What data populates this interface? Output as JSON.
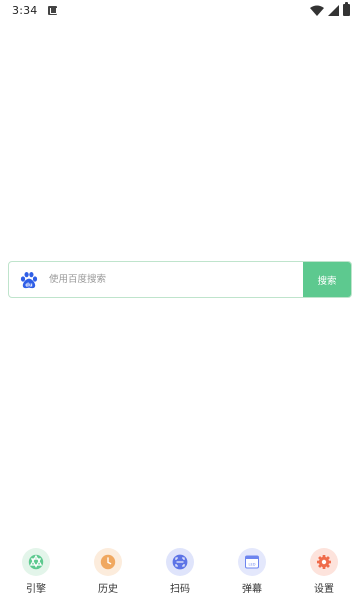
{
  "status_bar": {
    "time": "3:34",
    "icons": [
      "notification-icon",
      "wifi-icon",
      "signal-icon",
      "battery-icon"
    ]
  },
  "search": {
    "engine_icon": "baidu-logo-icon",
    "placeholder": "使用百度搜索",
    "value": "",
    "button_label": "搜索",
    "accent_color": "#5dc98f",
    "border_color": "#bfe4cc"
  },
  "bottom_nav": {
    "items": [
      {
        "label": "引擎",
        "icon": "engine-icon",
        "color": "#5dc98f",
        "bg": "#e3f5ea"
      },
      {
        "label": "历史",
        "icon": "history-icon",
        "color": "#f0a860",
        "bg": "#fcecdc"
      },
      {
        "label": "扫码",
        "icon": "scan-icon",
        "color": "#5d74e6",
        "bg": "#dfe4fb"
      },
      {
        "label": "弹幕",
        "icon": "danmaku-icon",
        "color": "#6d85ef",
        "bg": "#e4e8fc"
      },
      {
        "label": "设置",
        "icon": "settings-icon",
        "color": "#f06b4a",
        "bg": "#fde3dc"
      }
    ]
  }
}
